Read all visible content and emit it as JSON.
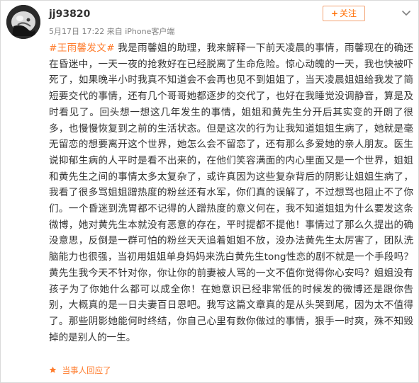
{
  "post": {
    "username": "jj93820",
    "timestamp": "5月17日 17:22",
    "source_prefix": " 来自",
    "source": " iPhone客户端",
    "follow_label": "关注",
    "topic": "#王雨馨发文#",
    "body": " 我是雨馨姐的助理，我来解释一下前天凌晨的事情，雨馨现在的确还在昏迷中，一天一夜的抢救好在已经脱离了生命危险。惊心动魄的一天，我也快被吓死了，如果晚半小时我真不知道会不会再也见不到姐姐了，当天凌晨姐姐给我发了简短要交代的事情，还有几个哥哥她都逐步的交代了，也好在我睡觉没调静音，算是及时看见了。回头想一想这几年发生的事情，姐姐和黄先生分开后其实变的开朗了很多，也慢慢恢复到之前的生活状态。但是这次的行为让我知道姐姐生病了，她就是毫无留恋的想要离开这个世界，她怎么会不留恋了，还有那么多爱她的亲人朋友。医生说抑郁生病的人平时是看不出来的，在他们笑容满面的内心里面又是一个世界，姐姐和黄先生之间的事情太多太复杂了，或许真因为这些复杂背后的阴影让姐姐生病了，我看了很多骂姐姐蹭热度的粉丝还有水军，你们真的误解了，不过想骂也阻止不了你们。一个昏迷到洗胃都不记得的人蹭热度的意义何在，我不知道姐姐为什么要发这条微博，她对黄先生本就没有恶意的存在，平时提都不提他！事情过了那么久提出的确没意思，反倒是一群可怕的粉丝天天追着姐姐不放，没办法黄先生太厉害了，团队洗脑能力也很强，当初用姐姐单身妈妈来洗白黄先生tong性恋的剧不就是一个手段吗？黄先生我今天不针对你，你让你的前妻被人骂的一文不值你觉得你心安吗？姐姐没有孩子为了你她什么都可以成全你！在她意识已经非常低的时候发的微博还是跟你告别，大概真的是一日夫妻百日恩吧。我写这篇文章真的是从头哭到尾，因为太不值得了。那些阴影她能何时终结，你自己心里有数你做过的事情，狠手一时爽，殊不知毁掉的是别人的一生。",
    "reply_notice": "当事人回应了"
  },
  "colors": {
    "accent": "#ff7b2b",
    "follow_border": "#f3a374",
    "text": "#333333",
    "meta": "#808080"
  },
  "icons": {
    "avatar": "avatar",
    "menu": "chevron-down-icon",
    "reply": "star-icon"
  }
}
